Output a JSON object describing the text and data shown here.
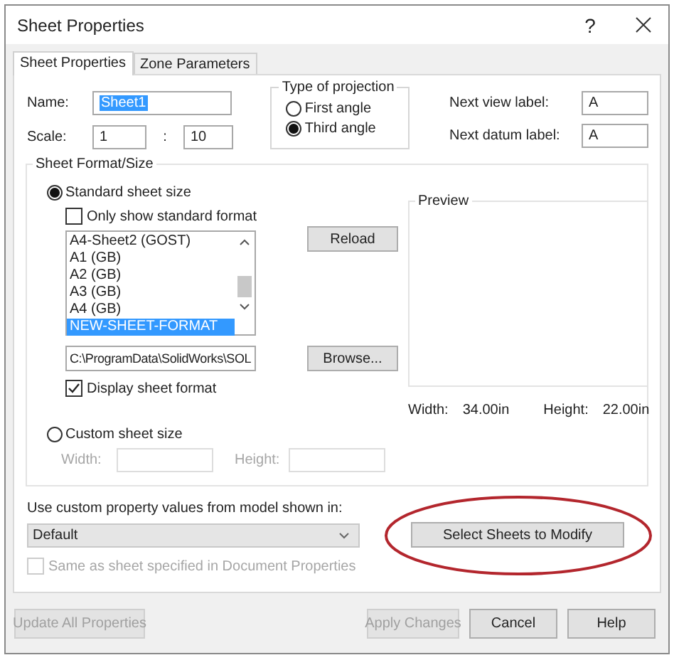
{
  "window": {
    "title": "Sheet Properties",
    "help": "?"
  },
  "tabs": [
    {
      "label": "Sheet Properties",
      "selected": true
    },
    {
      "label": "Zone Parameters",
      "selected": false
    }
  ],
  "name": {
    "label": "Name:",
    "value": "Sheet1",
    "text_selected": true
  },
  "scale": {
    "label": "Scale:",
    "numerator": "1",
    "separator": ":",
    "denominator": "10"
  },
  "projection": {
    "title": "Type of projection",
    "options": [
      {
        "label": "First angle",
        "selected": false
      },
      {
        "label": "Third angle",
        "selected": true
      }
    ]
  },
  "next_view_label": {
    "label": "Next view label:",
    "value": "A"
  },
  "next_datum_label": {
    "label": "Next datum label:",
    "value": "A"
  },
  "sheet_format": {
    "title": "Sheet Format/Size",
    "standard": {
      "label": "Standard sheet size",
      "selected": true
    },
    "only_standard": {
      "label": "Only show standard format",
      "checked": false
    },
    "formats": [
      {
        "label": "A4-Sheet2 (GOST)",
        "selected": false
      },
      {
        "label": "A1 (GB)",
        "selected": false
      },
      {
        "label": "A2 (GB)",
        "selected": false
      },
      {
        "label": "A3 (GB)",
        "selected": false
      },
      {
        "label": "A4 (GB)",
        "selected": false
      },
      {
        "label": "NEW-SHEET-FORMAT",
        "selected": true
      }
    ],
    "reload": "Reload",
    "path": "C:\\ProgramData\\SolidWorks\\SOL",
    "browse": "Browse...",
    "display_format": {
      "label": "Display sheet format",
      "checked": true
    },
    "preview": {
      "title": "Preview"
    },
    "width_label": "Width:",
    "width_value": "34.00in",
    "height_label": "Height:",
    "height_value": "22.00in",
    "custom": {
      "label": "Custom sheet size",
      "selected": false
    },
    "custom_width_label": "Width:",
    "custom_height_label": "Height:"
  },
  "custom_property": {
    "label": "Use custom property values from model shown in:",
    "value": "Default",
    "same_as": {
      "label": "Same as sheet specified in Document Properties",
      "checked": false,
      "disabled": true
    }
  },
  "select_sheets": "Select Sheets to Modify",
  "footer_buttons": [
    {
      "label": "Update All Properties",
      "disabled": true,
      "kind": "left"
    },
    {
      "label": "Apply Changes",
      "disabled": true,
      "kind": "right"
    },
    {
      "label": "Cancel",
      "disabled": false,
      "kind": "right"
    },
    {
      "label": "Help",
      "disabled": false,
      "kind": "right"
    }
  ]
}
